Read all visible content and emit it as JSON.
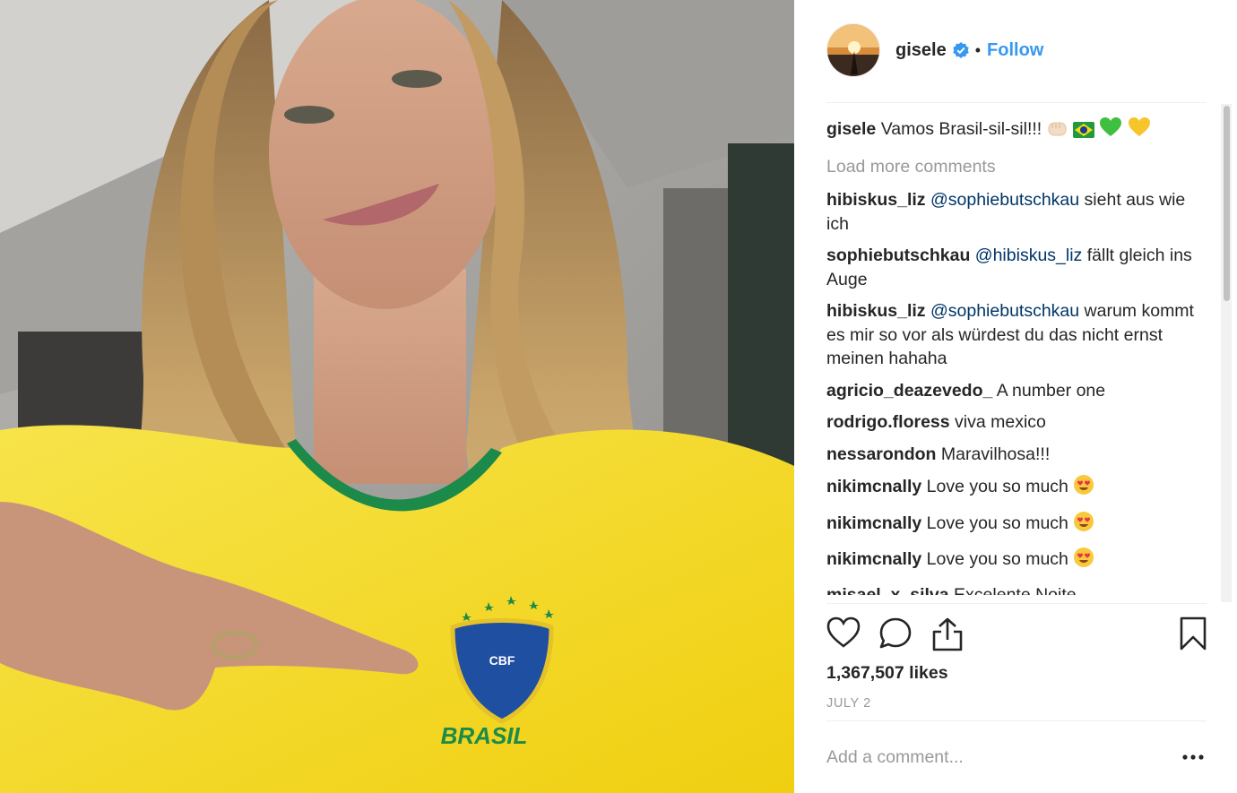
{
  "post": {
    "photo_alt": "",
    "jersey_text": "BRASIL",
    "badge_text": "CBF"
  },
  "header": {
    "username": "gisele",
    "separator": "•",
    "follow_label": "Follow"
  },
  "caption": {
    "user": "gisele",
    "text": "Vamos Brasil-sil-sil!!!"
  },
  "load_more_label": "Load more comments",
  "comments": [
    {
      "user": "hibiskus_liz",
      "mention": "@sophiebutschkau",
      "text": " sieht aus wie ich"
    },
    {
      "user": "sophiebutschkau",
      "mention": "@hibiskus_liz",
      "text": " fällt gleich ins Auge"
    },
    {
      "user": "hibiskus_liz",
      "mention": "@sophiebutschkau",
      "text": " warum kommt es mir so vor als würdest du das nicht ernst meinen hahaha"
    },
    {
      "user": "agricio_deazevedo_",
      "mention": "",
      "text": "A number one"
    },
    {
      "user": "rodrigo.floress",
      "mention": "",
      "text": "viva mexico"
    },
    {
      "user": "nessarondon",
      "mention": "",
      "text": "Maravilhosa!!!"
    },
    {
      "user": "nikimcnally",
      "mention": "",
      "text": "Love you so much"
    },
    {
      "user": "nikimcnally",
      "mention": "",
      "text": "Love you so much"
    },
    {
      "user": "nikimcnally",
      "mention": "",
      "text": "Love you so much"
    },
    {
      "user": "misael_x_silva",
      "mention": "",
      "text": "Excelente Noite"
    }
  ],
  "stats": {
    "likes": "1,367,507 likes",
    "date": "JULY 2"
  },
  "composer": {
    "placeholder": "Add a comment..."
  },
  "icons": {
    "like": "heart-icon",
    "comment": "comment-bubble-icon",
    "share": "share-icon",
    "save": "bookmark-icon",
    "more": "more-options-icon",
    "verified": "verified-badge-icon"
  },
  "colors": {
    "link_blue": "#3897f0",
    "mention_blue": "#003569",
    "muted_gray": "#999999",
    "jersey_yellow": "#f5d916"
  }
}
